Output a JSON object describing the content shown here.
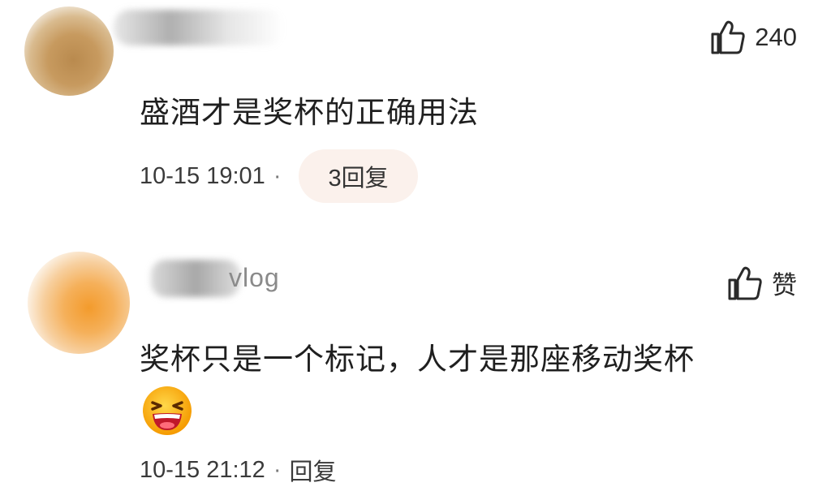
{
  "comments": [
    {
      "like_icon": "thumbs-up-outline-icon",
      "like_label": "240",
      "text": "盛酒才是奖杯的正确用法",
      "time": "10-15 19:01",
      "separator": "·",
      "reply_label": "3回复"
    },
    {
      "username_visible_fragment": "vlog",
      "like_icon": "thumbs-up-outline-icon",
      "like_label": "赞",
      "text": "奖杯只是一个标记，人才是那座移动奖杯",
      "emoji": "laughing-emoji-icon",
      "time": "10-15 21:12",
      "separator": "·",
      "reply_label": "回复"
    }
  ],
  "colors": {
    "reply_pill_bg": "#fbf1ec",
    "text_primary": "#1f1f1f",
    "text_meta": "#3a3a3a",
    "emoji_yellow": "#ffb000"
  }
}
